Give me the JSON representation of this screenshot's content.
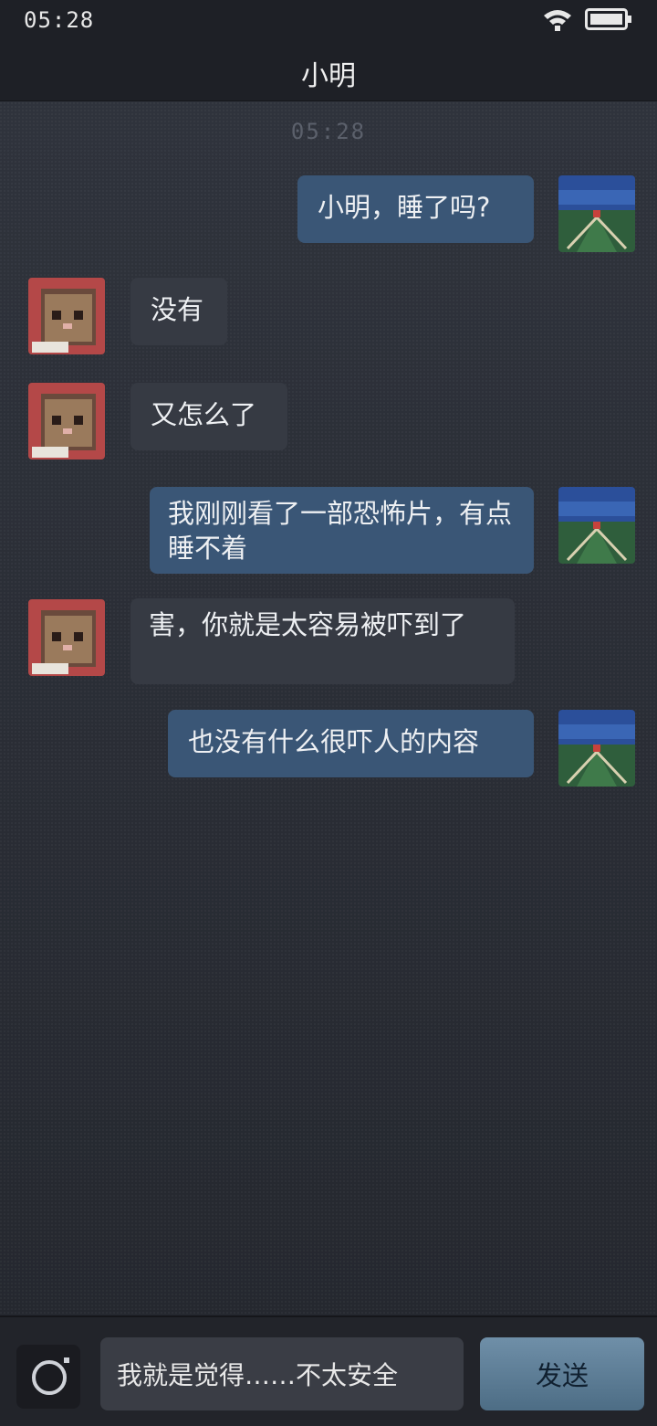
{
  "status_bar": {
    "time": "05:28"
  },
  "header": {
    "title": "小明"
  },
  "chat": {
    "timestamp": "05:28",
    "messages": [
      {
        "sender": "me",
        "text": "小明，睡了吗?"
      },
      {
        "sender": "them",
        "text": "没有"
      },
      {
        "sender": "them",
        "text": "又怎么了"
      },
      {
        "sender": "me",
        "text": "我刚刚看了一部恐怖片，有点睡不着"
      },
      {
        "sender": "them",
        "text": "害，你就是太容易被吓到了"
      },
      {
        "sender": "me",
        "text": "也没有什么很吓人的内容"
      }
    ]
  },
  "composer": {
    "input_value": "我就是觉得……不太安全",
    "send_label": "发送"
  },
  "colors": {
    "my_bubble": "#3a5676",
    "their_bubble": "#363a43",
    "send_button": "#5f7f97"
  }
}
